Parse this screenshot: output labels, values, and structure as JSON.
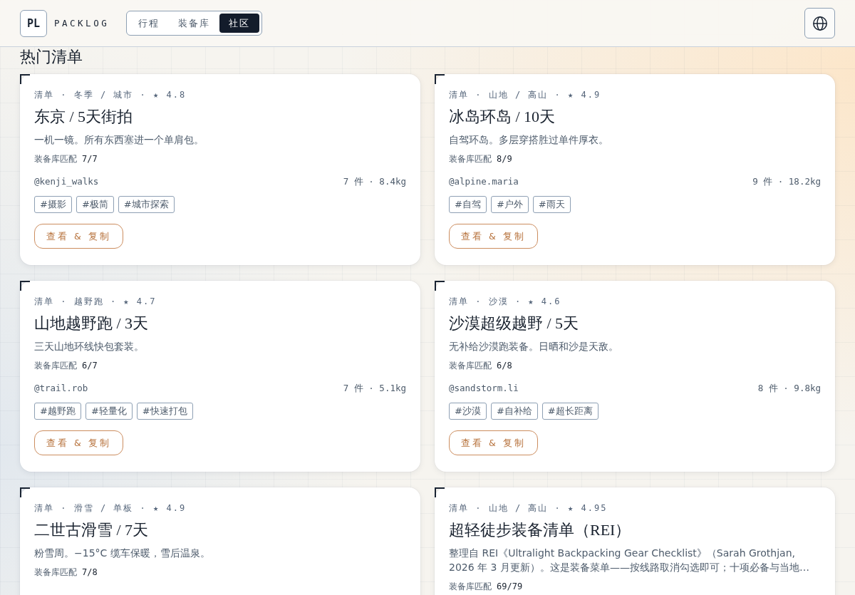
{
  "header": {
    "logo": "PL",
    "brand": "PACKLOG",
    "tabs": [
      {
        "label": "行程",
        "selected": false
      },
      {
        "label": "装备库",
        "selected": false
      },
      {
        "label": "社区",
        "selected": true
      }
    ]
  },
  "section": {
    "title": "热门清单",
    "cards": [
      {
        "meta": "清单 · 冬季 / 城市 · ★ 4.8",
        "title": "东京 / 5天街拍",
        "description": "一机一镜。所有东西塞进一个单肩包。",
        "match_label": "装备库匹配",
        "match": "7/7",
        "author": "@kenji_walks",
        "summary": "7 件 · 8.4kg",
        "tags": [
          "#摄影",
          "#极简",
          "#城市探索"
        ],
        "action": "查看 & 复制"
      },
      {
        "meta": "清单 · 山地 / 高山 · ★ 4.9",
        "title": "冰岛环岛 / 10天",
        "description": "自驾环岛。多层穿搭胜过单件厚衣。",
        "match_label": "装备库匹配",
        "match": "8/9",
        "author": "@alpine.maria",
        "summary": "9 件 · 18.2kg",
        "tags": [
          "#自驾",
          "#户外",
          "#雨天"
        ],
        "action": "查看 & 复制"
      },
      {
        "meta": "清单 · 越野跑 · ★ 4.7",
        "title": "山地越野跑 / 3天",
        "description": "三天山地环线快包套装。",
        "match_label": "装备库匹配",
        "match": "6/7",
        "author": "@trail.rob",
        "summary": "7 件 · 5.1kg",
        "tags": [
          "#越野跑",
          "#轻量化",
          "#快速打包"
        ],
        "action": "查看 & 复制"
      },
      {
        "meta": "清单 · 沙漠 · ★ 4.6",
        "title": "沙漠超级越野 / 5天",
        "description": "无补给沙漠跑装备。日晒和沙是天敌。",
        "match_label": "装备库匹配",
        "match": "6/8",
        "author": "@sandstorm.li",
        "summary": "8 件 · 9.8kg",
        "tags": [
          "#沙漠",
          "#自补给",
          "#超长距离"
        ],
        "action": "查看 & 复制"
      },
      {
        "meta": "清单 · 滑雪 / 单板 · ★ 4.9",
        "title": "二世古滑雪 / 7天",
        "description": "粉雪周。−15°C 缆车保暖，雪后温泉。",
        "match_label": "装备库匹配",
        "match": "7/8"
      },
      {
        "meta": "清单 · 山地 / 高山 · ★ 4.95",
        "title": "超轻徒步装备清单（REI）",
        "description": "整理自 REI《Ultralight Backpacking Gear Checklist》（Sarah Grothjan, 2026 年 3 月更新）。这是装备菜单——按线路取消勾选即可；十项必备与当地…",
        "match_label": "装备库匹配",
        "match": "69/79"
      }
    ]
  }
}
